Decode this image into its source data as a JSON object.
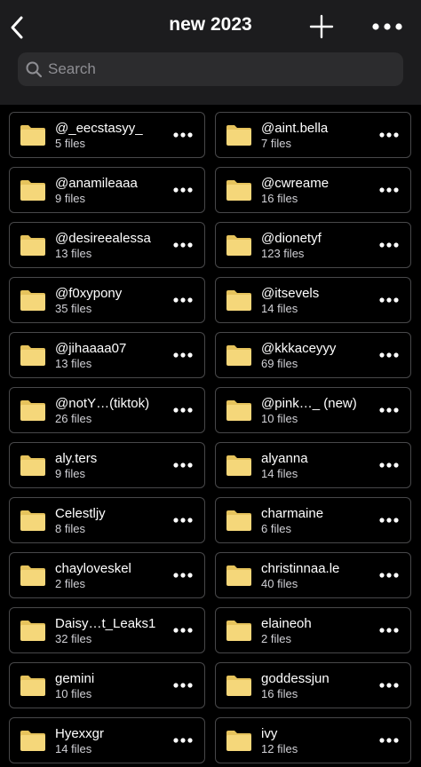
{
  "header": {
    "title": "new 2023"
  },
  "search": {
    "placeholder": "Search"
  },
  "colors": {
    "folder": "#f5d77a",
    "folder_dark": "#e6c35c",
    "card_border": "#48484a",
    "header_bg": "#1c1c1e"
  },
  "folders": [
    {
      "name": "@_eecstasyy_",
      "count": "5 files"
    },
    {
      "name": "@aint.bella",
      "count": "7 files"
    },
    {
      "name": "@anamileaaa",
      "count": "9 files"
    },
    {
      "name": "@cwreame",
      "count": "16 files"
    },
    {
      "name": "@desireealessa",
      "count": "13 files"
    },
    {
      "name": "@dionetyf",
      "count": "123 files"
    },
    {
      "name": "@f0xypony",
      "count": "35 files"
    },
    {
      "name": "@itsevels",
      "count": "14 files"
    },
    {
      "name": "@jihaaaa07",
      "count": "13 files"
    },
    {
      "name": "@kkkaceyyy",
      "count": "69 files"
    },
    {
      "name": "@notY…(tiktok)",
      "count": "26 files"
    },
    {
      "name": "@pink…_ (new)",
      "count": "10 files"
    },
    {
      "name": "aly.ters",
      "count": "9 files"
    },
    {
      "name": "alyanna",
      "count": "14 files"
    },
    {
      "name": "Celestljy",
      "count": "8 files"
    },
    {
      "name": "charmaine",
      "count": "6 files"
    },
    {
      "name": "chayloveskel",
      "count": "2 files"
    },
    {
      "name": "christinnaa.le",
      "count": "40 files"
    },
    {
      "name": "Daisy…t_Leaks1",
      "count": "32 files"
    },
    {
      "name": "elaineoh",
      "count": "2 files"
    },
    {
      "name": "gemini",
      "count": "10 files"
    },
    {
      "name": "goddessjun",
      "count": "16 files"
    },
    {
      "name": "Hyexxgr",
      "count": "14 files"
    },
    {
      "name": "ivy",
      "count": "12 files"
    }
  ]
}
